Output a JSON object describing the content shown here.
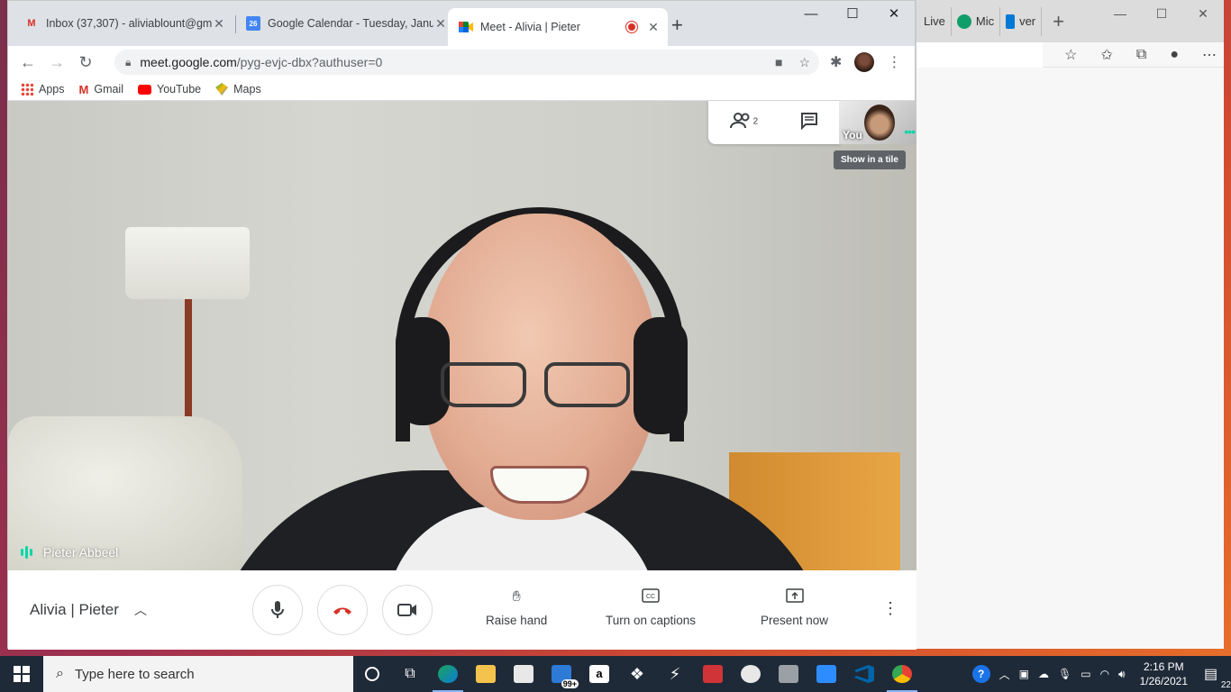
{
  "edge": {
    "tabs": [
      {
        "label": "Live",
        "icon": "edge-tab-icon"
      },
      {
        "label": "Mic",
        "icon": "edge-logo-icon",
        "color": "#0f9e6a"
      },
      {
        "label": "ver",
        "icon": "bing-icon",
        "color": "#0078d4"
      }
    ]
  },
  "chrome": {
    "tabs": [
      {
        "title": "Inbox (37,307) - aliviablount@gm",
        "icon": "gmail-icon"
      },
      {
        "title": "Google Calendar - Tuesday, Janu",
        "icon": "calendar-icon",
        "icon_text": "26"
      },
      {
        "title": "Meet - Alivia | Pieter",
        "icon": "meet-icon",
        "active": true
      }
    ],
    "url_host": "meet.google.com",
    "url_path": "/pyg-evjc-dbx?authuser=0",
    "bookmarks": [
      {
        "label": "Apps",
        "icon": "apps-grid-icon"
      },
      {
        "label": "Gmail",
        "icon": "gmail-icon"
      },
      {
        "label": "YouTube",
        "icon": "youtube-icon"
      },
      {
        "label": "Maps",
        "icon": "maps-icon"
      }
    ]
  },
  "meet": {
    "speaker_name": "Pieter Abbeel",
    "participant_count": "2",
    "self_label": "You",
    "tooltip": "Show in a tile",
    "meeting_title": "Alivia | Pieter",
    "actions": {
      "raise_hand": "Raise hand",
      "captions": "Turn on captions",
      "present": "Present now"
    },
    "colors": {
      "accent": "#00d6a8",
      "hangup": "#d93025"
    }
  },
  "taskbar": {
    "search_placeholder": "Type here to search",
    "mail_badge": "99+",
    "time": "2:16 PM",
    "date": "1/26/2021",
    "notification_count": "22"
  }
}
